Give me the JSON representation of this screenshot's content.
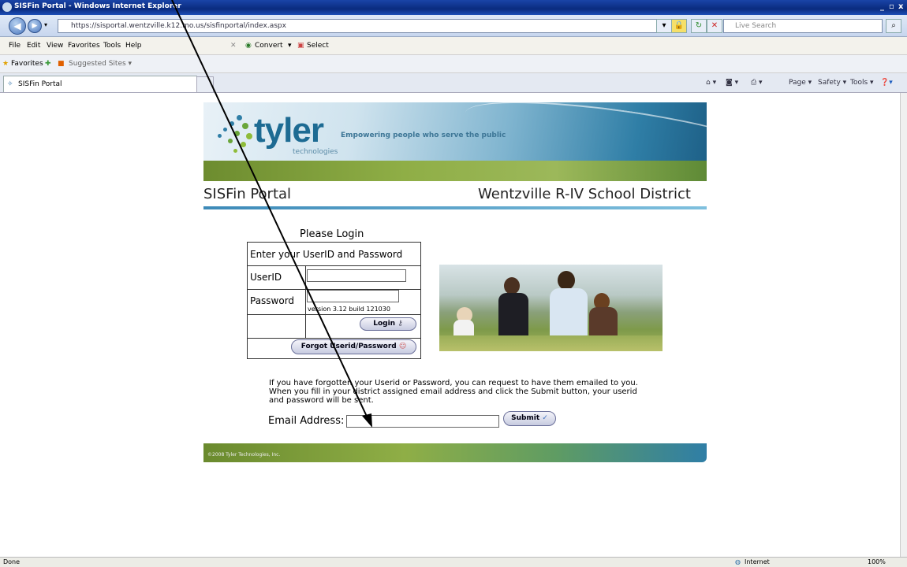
{
  "window": {
    "title": "SISFin Portal - Windows Internet Explorer",
    "controls": [
      "_",
      "▫",
      "x"
    ]
  },
  "address_bar": {
    "url": "https://sisportal.wentzville.k12.mo.us/sisfinportal/index.aspx",
    "search_placeholder": "Live Search"
  },
  "menu": [
    "File",
    "Edit",
    "View",
    "Favorites",
    "Tools",
    "Help"
  ],
  "toolbar_extra": {
    "convert": "Convert",
    "select": "Select"
  },
  "favorites_bar": {
    "favorites": "Favorites",
    "suggested": "Suggested Sites ▾"
  },
  "tab": {
    "label": "SISFin Portal"
  },
  "command_bar": [
    "Page ▾",
    "Safety ▾",
    "Tools ▾"
  ],
  "banner": {
    "logo": "tyler",
    "logo_sub": "technologies",
    "tagline": "Empowering people who serve the public"
  },
  "header": {
    "portal": "SISFin Portal",
    "district": "Wentzville R-IV School District"
  },
  "login": {
    "heading": "Please Login",
    "instruction": "Enter your UserID and Password",
    "userid_label": "UserID",
    "userid_value": "",
    "password_label": "Password",
    "password_value": "",
    "version": "version 3.12    build 121030",
    "login_button": "Login",
    "forgot_button": "Forgot Userid/Password"
  },
  "help_text": "If you have forgotten your Userid or Password, you can request to have them emailed to you. When you fill in your district assigned email address and click the Submit button, your userid and password will be sent.",
  "email": {
    "label": "Email Address:",
    "value": "",
    "submit": "Submit"
  },
  "footer": {
    "copyright": "©2008 Tyler Technologies, Inc."
  },
  "status": {
    "left": "Done",
    "zone": "Internet",
    "zoom": "100%"
  },
  "colors": {
    "accent": "#1d6b93",
    "banner_green": "#8fae46"
  },
  "icons": [
    "back-icon",
    "forward-icon",
    "lock-icon",
    "refresh-icon",
    "stop-icon",
    "search-icon",
    "home-icon",
    "rss-icon",
    "print-icon",
    "help-icon",
    "key-icon",
    "people-icon",
    "checkmark-icon",
    "globe-icon"
  ]
}
